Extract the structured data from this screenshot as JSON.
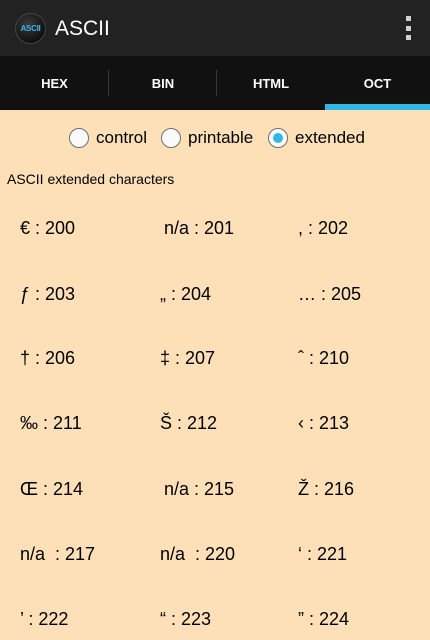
{
  "appbar": {
    "title": "ASCII",
    "icon_text": "ASCII"
  },
  "tabs": [
    {
      "label": "HEX",
      "active": false
    },
    {
      "label": "BIN",
      "active": false
    },
    {
      "label": "HTML",
      "active": false
    },
    {
      "label": "OCT",
      "active": true
    }
  ],
  "radio_group": {
    "options": [
      {
        "label": "control",
        "checked": false
      },
      {
        "label": "printable",
        "checked": false
      },
      {
        "label": "extended",
        "checked": true
      }
    ]
  },
  "section": {
    "title": "ASCII extended characters"
  },
  "grid": [
    [
      "€ : 200",
      "n/a : 201",
      ", : 202"
    ],
    [
      "ƒ : 203",
      "„ : 204",
      "… : 205"
    ],
    [
      "† : 206",
      "‡ : 207",
      "ˆ : 210"
    ],
    [
      "‰ : 211",
      "Š : 212",
      "‹ : 213"
    ],
    [
      "Œ : 214",
      "n/a : 215",
      "Ž : 216"
    ],
    [
      "n/a  : 217",
      "n/a  : 220",
      "‘ : 221"
    ],
    [
      "’ : 222",
      "“ : 223",
      "” : 224"
    ]
  ],
  "colors": {
    "background": "#fde0b8",
    "accent": "#33b5e5",
    "appbar": "#222222",
    "tabbar": "#111111"
  }
}
